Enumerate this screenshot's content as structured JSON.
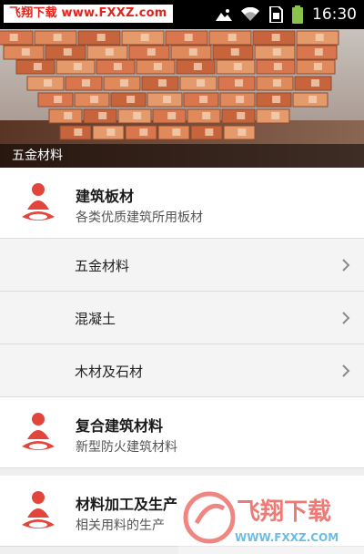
{
  "watermark": {
    "top_text": "飞翔下载 www.FXXZ.com",
    "bottom_brand": "飞翔下载",
    "bottom_url": "WWW.FXXZ.COM"
  },
  "status_bar": {
    "time": "16:30",
    "icons": [
      "photo-icon",
      "wifi-icon",
      "sim-icon",
      "battery-icon"
    ]
  },
  "banner": {
    "caption": "五金材料"
  },
  "categories": [
    {
      "title": "建筑板材",
      "subtitle": "各类优质建筑所用板材",
      "icon": "person-meditating-icon",
      "items": [
        "五金材料",
        "混凝土",
        "木材及石材"
      ]
    },
    {
      "title": "复合建筑材料",
      "subtitle": "新型防火建筑材料",
      "icon": "person-meditating-icon",
      "items": []
    },
    {
      "title": "材料加工及生产",
      "subtitle": "相关用料的生产",
      "icon": "person-meditating-icon",
      "items": []
    }
  ],
  "colors": {
    "accent": "#e2453c",
    "watermark": "#e4231b",
    "status_bar": "#000000"
  }
}
